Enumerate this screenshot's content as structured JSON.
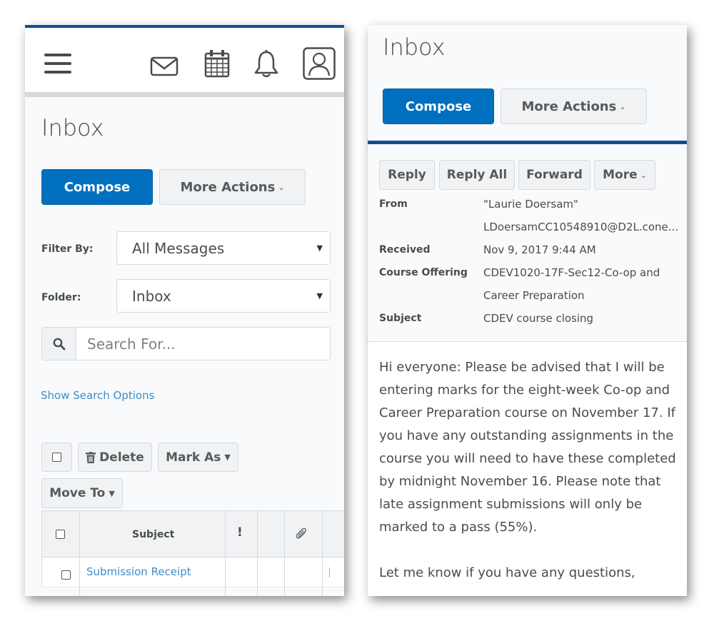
{
  "left": {
    "nav_icons": [
      "menu-icon",
      "mail-icon",
      "calendar-icon",
      "bell-icon",
      "user-icon"
    ],
    "title": "Inbox",
    "compose_label": "Compose",
    "more_actions_label": "More Actions",
    "filter_label": "Filter By:",
    "filter_value": "All Messages",
    "folder_label": "Folder:",
    "folder_value": "Inbox",
    "search_placeholder": "Search For...",
    "show_search_options": "Show Search Options",
    "delete_label": "Delete",
    "mark_as_label": "Mark As",
    "move_to_label": "Move To",
    "columns": {
      "subject": "Subject",
      "importance": "!"
    },
    "rows": [
      {
        "subject": "Submission Receipt"
      }
    ]
  },
  "right": {
    "title": "Inbox",
    "compose_label": "Compose",
    "more_actions_label": "More Actions",
    "actions": {
      "reply": "Reply",
      "reply_all": "Reply All",
      "forward": "Forward",
      "more": "More"
    },
    "meta": {
      "from_label": "From",
      "from_name": "\"Laurie Doersam\"",
      "from_email": "LDoersamCC10548910@D2L.cone...",
      "received_label": "Received",
      "received_value": "Nov 9, 2017 9:44 AM",
      "course_label": "Course Offering",
      "course_line1": "CDEV1020-17F-Sec12-Co-op and",
      "course_line2": "Career Preparation",
      "subject_label": "Subject",
      "subject_value": "CDEV course closing"
    },
    "body_lines": [
      "Hi everyone:  Please be advised that I will be",
      "entering marks for the eight-week Co-op and",
      "Career Preparation course on November 17.  If",
      "you have any outstanding assignments in the",
      "course you will need to have these completed",
      "by midnight November 16.  Please note that",
      "late assignment submissions will only be",
      "marked to a pass (55%).",
      "",
      "Let me know if you have any questions,"
    ]
  },
  "colors": {
    "primary": "#006fbf",
    "brand_bar": "#124e8f",
    "link": "#3c8dc5"
  }
}
